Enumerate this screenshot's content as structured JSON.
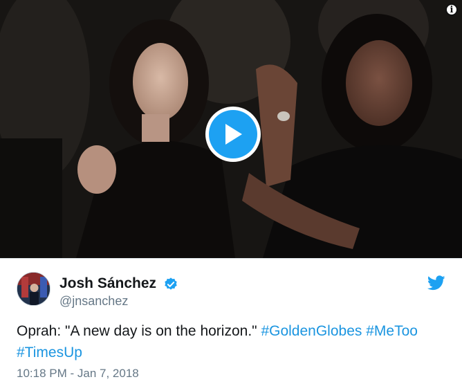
{
  "media": {
    "info_icon": "info-icon",
    "play_icon": "play-icon",
    "accent": "#1da1f2"
  },
  "tweet": {
    "author": {
      "display_name": "Josh Sánchez",
      "handle": "@jnsanchez",
      "verified": true,
      "verified_icon": "verified-badge-icon"
    },
    "brand_icon": "twitter-bird-icon",
    "text": "Oprah: \"A new day is on the horizon.\"",
    "hashtags": [
      "#GoldenGlobes",
      "#MeToo",
      "#TimesUp"
    ],
    "timestamp": "10:18 PM - Jan 7, 2018",
    "colors": {
      "text": "#14171a",
      "secondary": "#657786",
      "link": "#1b95e0",
      "brand": "#1da1f2"
    }
  }
}
